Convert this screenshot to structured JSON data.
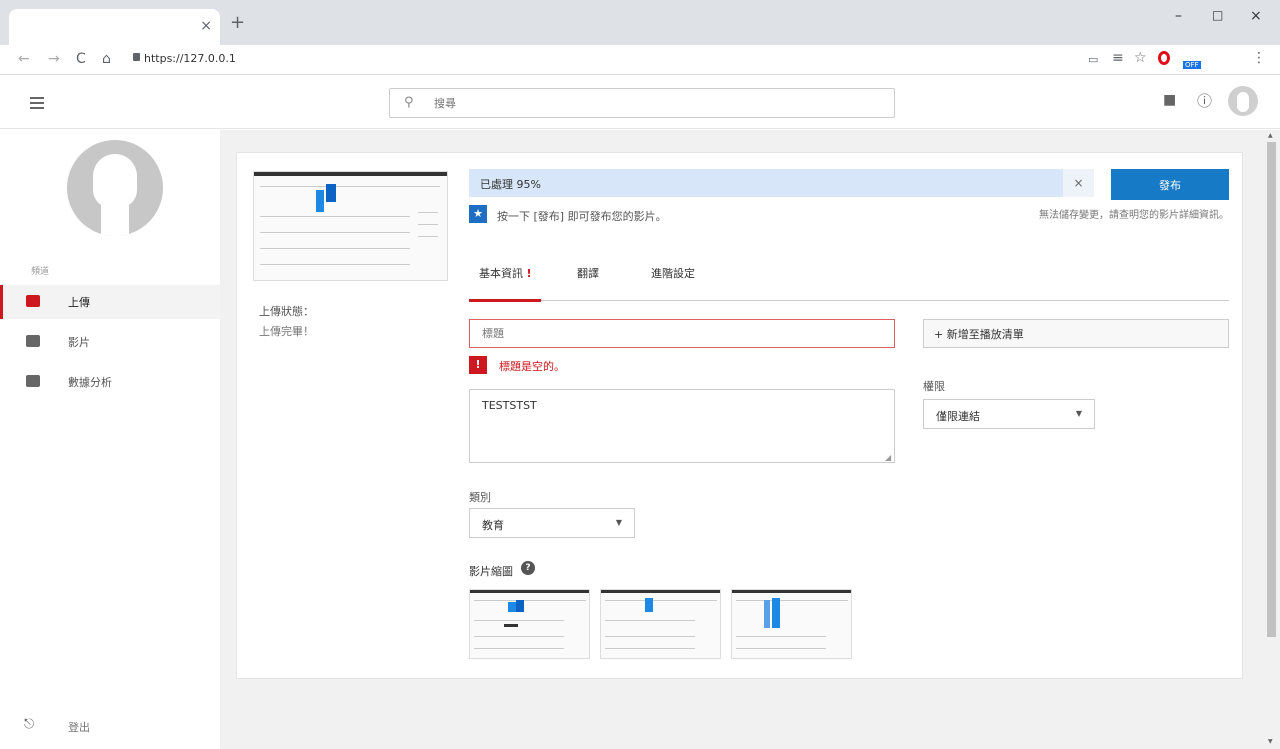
{
  "browser": {
    "new_tab": "+",
    "tab_close": "×",
    "window_controls": [
      "–",
      "□",
      "×"
    ],
    "url": "https://127.0.0.1",
    "nav": [
      "←",
      "→",
      "C",
      "⌂"
    ],
    "ext_icons": [
      "▭",
      "≡",
      "☆"
    ],
    "adblock_badge": "OFF",
    "menu": "⋮"
  },
  "header": {
    "search_placeholder": "搜尋",
    "search_icon": "🔍"
  },
  "sidebar": {
    "section": "頻道",
    "items": [
      {
        "label": "上傳",
        "icon": "upload-icon"
      },
      {
        "label": "影片",
        "icon": "video-icon"
      },
      {
        "label": "數據分析",
        "icon": "analytics-icon"
      }
    ],
    "logout": "登出"
  },
  "upload": {
    "status_label": "上傳狀態：",
    "status_value": "上傳完畢！",
    "progress_text": "已處理 95%",
    "progress_percent": 95,
    "close": "×",
    "publish": "發布",
    "hint": "按一下 [發布] 即可發布您的影片。",
    "hint_right": "無法儲存變更，請查明您的影片詳細資訊。",
    "tabs": [
      "基本資訊",
      "翻譯",
      "進階設定"
    ],
    "tab_warning": "!",
    "title_placeholder": "標題",
    "title_error": "標題是空的。",
    "description": "TESTSTST",
    "category_label": "類別",
    "category_value": "教育",
    "thumbnails_label": "影片縮圖",
    "playlist_button": "+ 新增至播放清單",
    "permission_label": "權限",
    "permission_value": "僅限連結"
  },
  "colors": {
    "accent": "#167ac6",
    "error": "#cc181e",
    "progress_bg": "#d7e7f9"
  }
}
